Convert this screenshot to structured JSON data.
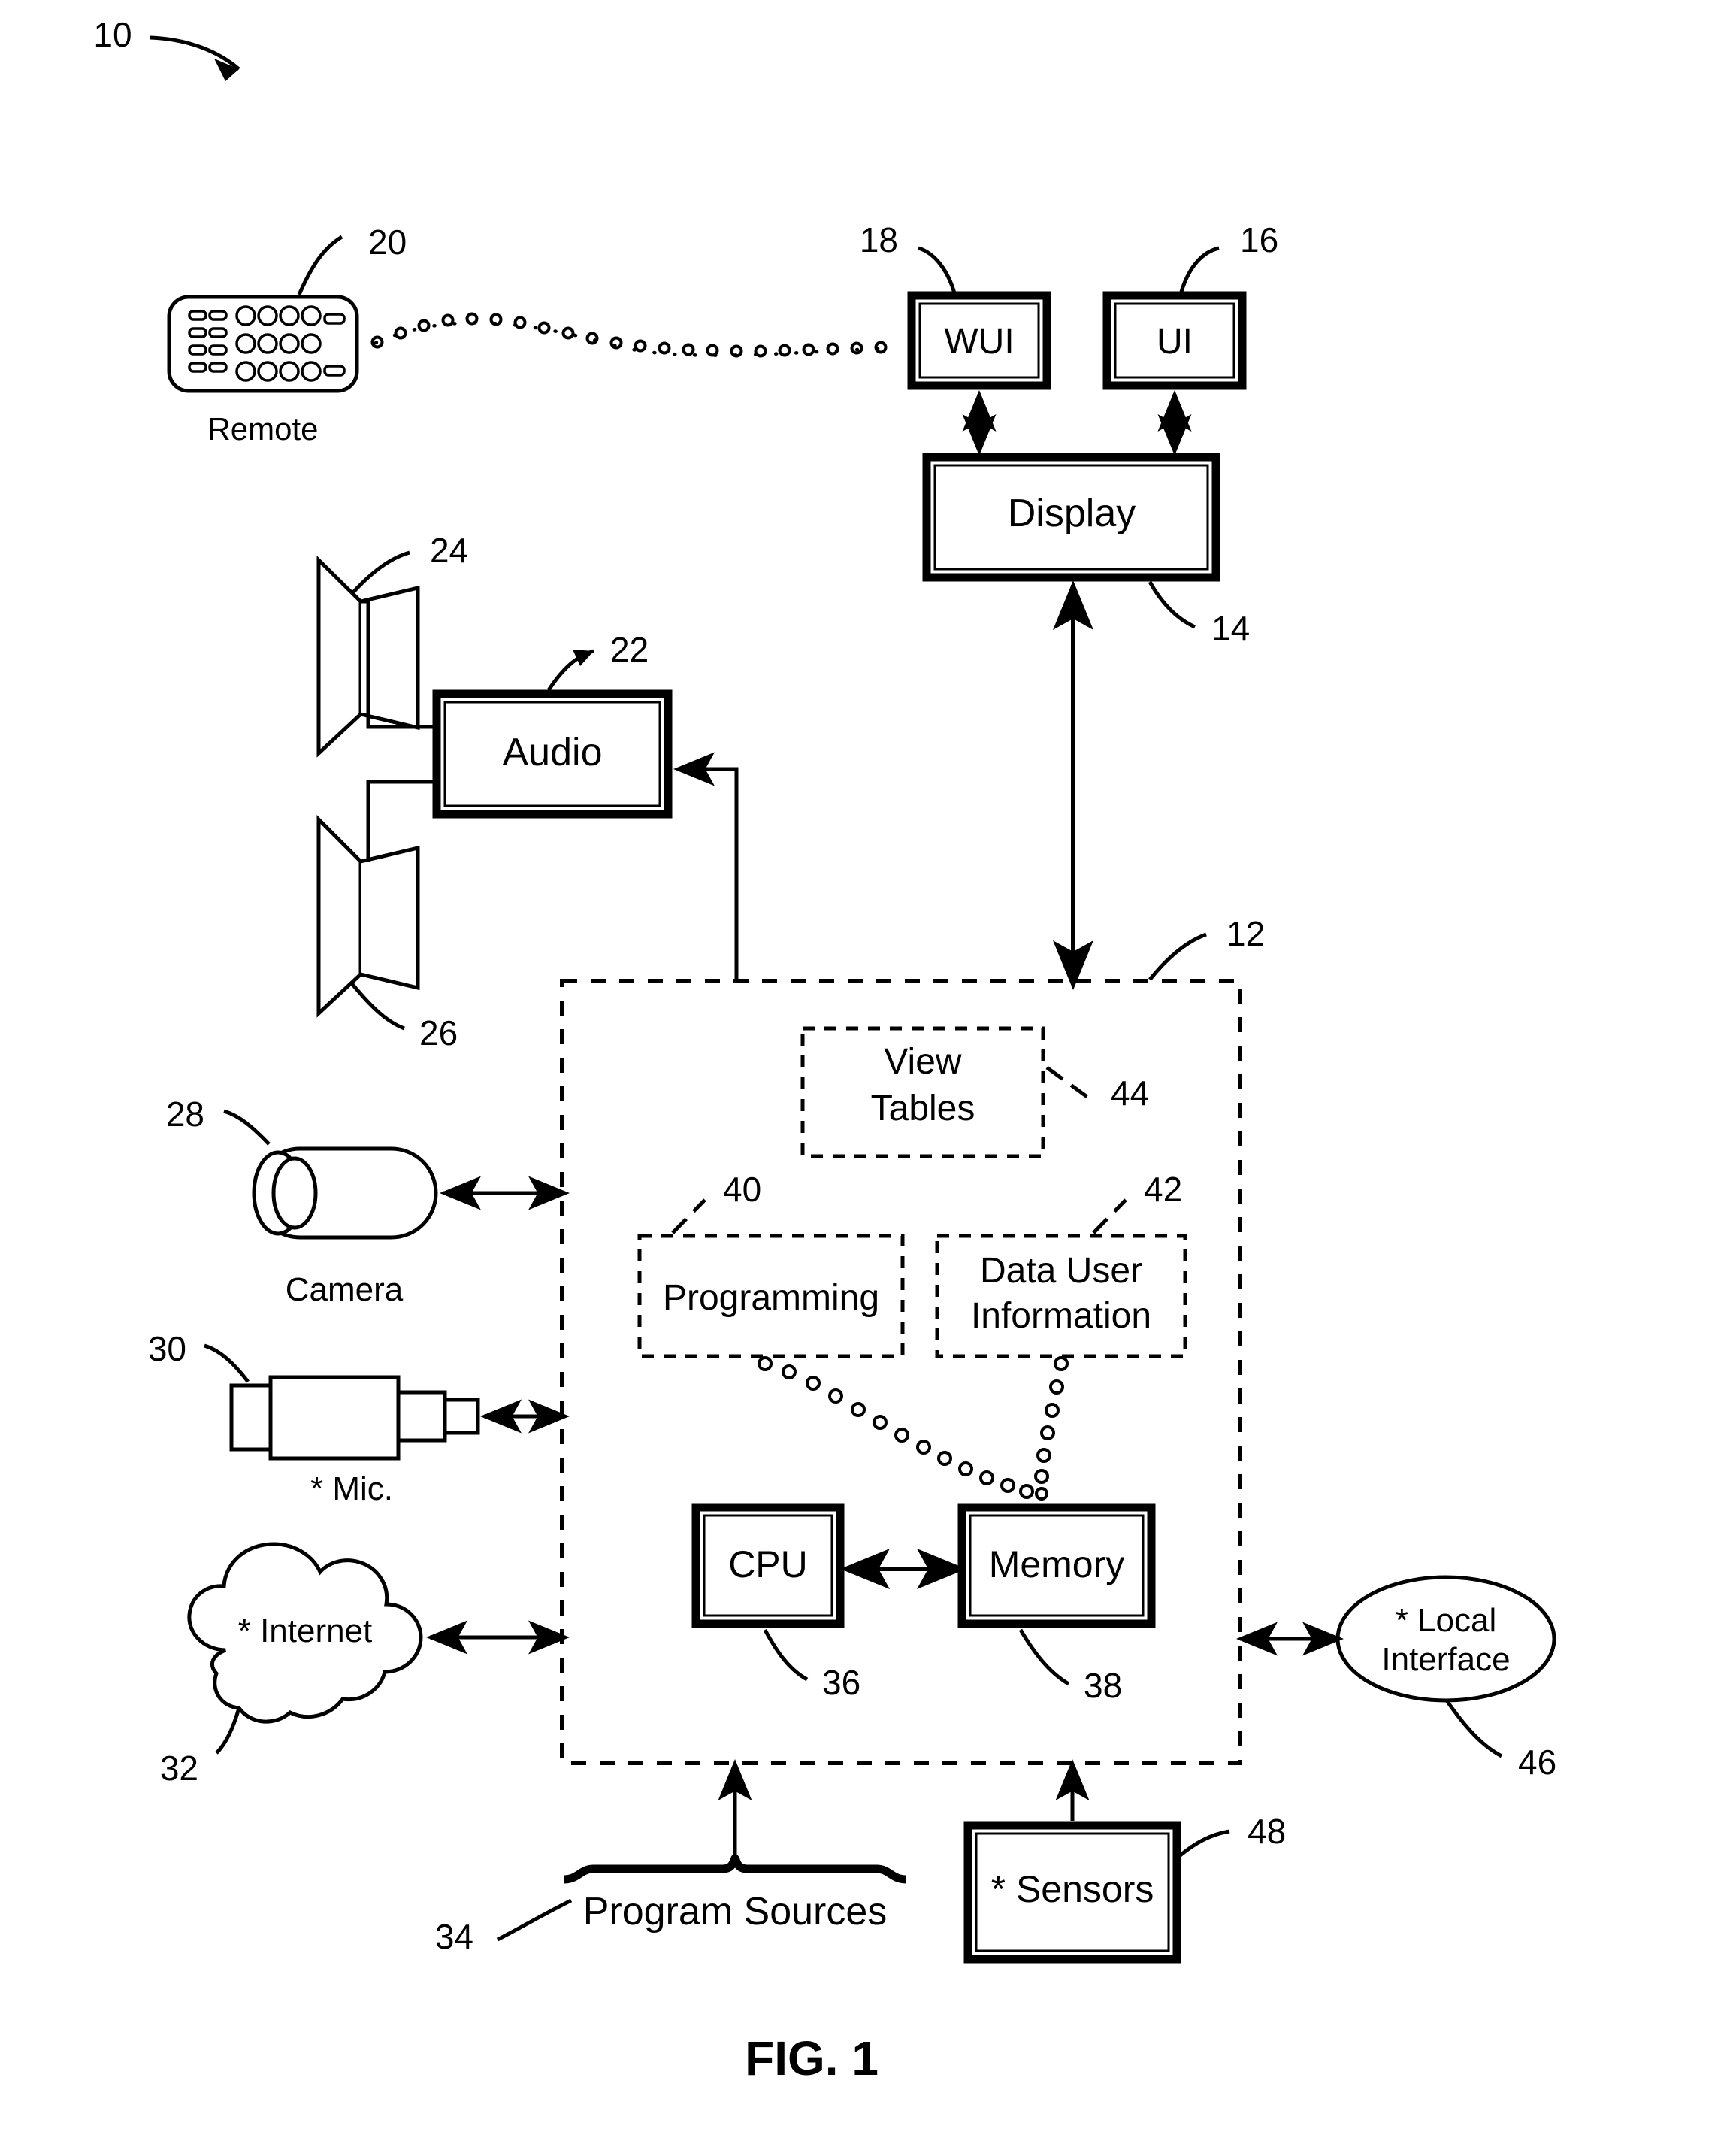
{
  "figure": {
    "caption": "FIG. 1",
    "system_ref": "10"
  },
  "nodes": {
    "remote": {
      "label": "Remote",
      "ref": "20"
    },
    "wui": {
      "label": "WUI",
      "ref": "18"
    },
    "ui": {
      "label": "UI",
      "ref": "16"
    },
    "display": {
      "label": "Display",
      "ref": "14"
    },
    "speaker_top": {
      "label": "",
      "ref": "24"
    },
    "audio": {
      "label": "Audio",
      "ref": "22"
    },
    "speaker_bottom": {
      "label": "",
      "ref": "26"
    },
    "camera": {
      "label": "Camera",
      "ref": "28"
    },
    "mic": {
      "label": "* Mic.",
      "ref": "30"
    },
    "internet": {
      "label": "* Internet",
      "ref": "32"
    },
    "program_sources": {
      "label": "Program Sources",
      "ref": "34"
    },
    "cpu": {
      "label": "CPU",
      "ref": "36"
    },
    "memory": {
      "label": "Memory",
      "ref": "38"
    },
    "programming": {
      "label": "Programming",
      "ref": "40"
    },
    "data_user_info_1": {
      "label": "Data User",
      "ref": "42"
    },
    "data_user_info_2": {
      "label": "Information",
      "ref": "42"
    },
    "view_tables_1": {
      "label": "View",
      "ref": "44"
    },
    "view_tables_2": {
      "label": "Tables",
      "ref": "44"
    },
    "local_interface_1": {
      "label": "* Local",
      "ref": "46"
    },
    "local_interface_2": {
      "label": "Interface",
      "ref": "46"
    },
    "sensors": {
      "label": "* Sensors",
      "ref": "48"
    },
    "system_box": {
      "label": "",
      "ref": "12"
    }
  },
  "refs": {
    "r10": "10",
    "r12": "12",
    "r14": "14",
    "r16": "16",
    "r18": "18",
    "r20": "20",
    "r22": "22",
    "r24": "24",
    "r26": "26",
    "r28": "28",
    "r30": "30",
    "r32": "32",
    "r34": "34",
    "r36": "36",
    "r38": "38",
    "r40": "40",
    "r42": "42",
    "r44": "44",
    "r46": "46",
    "r48": "48"
  },
  "colors": {
    "line": "#000000",
    "background": "#ffffff"
  }
}
